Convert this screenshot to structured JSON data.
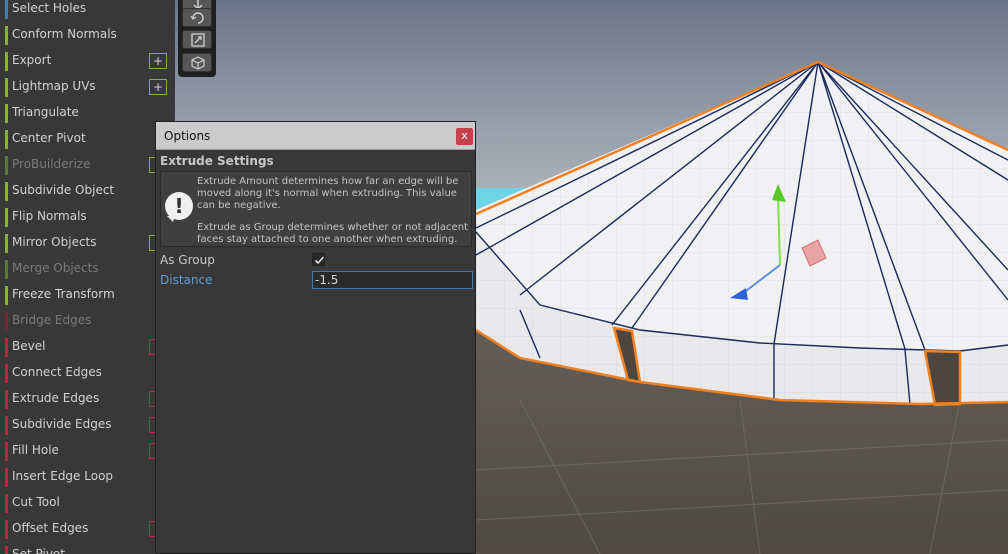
{
  "menu": {
    "items": [
      {
        "label": "Select Holes",
        "stripe": "#3c7fb5",
        "extra": "none",
        "disabled": false
      },
      {
        "label": "Conform Normals",
        "stripe": "#86b432",
        "extra": "none",
        "disabled": false
      },
      {
        "label": "Export",
        "stripe": "#86b432",
        "extra": "plus",
        "disabled": false
      },
      {
        "label": "Lightmap UVs",
        "stripe": "#86b432",
        "extra": "plus",
        "disabled": false
      },
      {
        "label": "Triangulate",
        "stripe": "#86b432",
        "extra": "none",
        "disabled": false
      },
      {
        "label": "Center Pivot",
        "stripe": "#86b432",
        "extra": "none",
        "disabled": false
      },
      {
        "label": "ProBuilderize",
        "stripe": "#5a7a30",
        "extra": "edge-green",
        "disabled": true
      },
      {
        "label": "Subdivide Object",
        "stripe": "#86b432",
        "extra": "none",
        "disabled": false
      },
      {
        "label": "Flip Normals",
        "stripe": "#86b432",
        "extra": "none",
        "disabled": false
      },
      {
        "label": "Mirror Objects",
        "stripe": "#86b432",
        "extra": "edge-green",
        "disabled": false
      },
      {
        "label": "Merge Objects",
        "stripe": "#5a7a30",
        "extra": "none",
        "disabled": true
      },
      {
        "label": "Freeze Transform",
        "stripe": "#86b432",
        "extra": "none",
        "disabled": false
      },
      {
        "label": "Bridge Edges",
        "stripe": "#6e2632",
        "extra": "none",
        "disabled": true
      },
      {
        "label": "Bevel",
        "stripe": "#b8273d",
        "extra": "edge",
        "disabled": false
      },
      {
        "label": "Connect Edges",
        "stripe": "#b8273d",
        "extra": "none",
        "disabled": false
      },
      {
        "label": "Extrude Edges",
        "stripe": "#b8273d",
        "extra": "edge",
        "disabled": false
      },
      {
        "label": "Subdivide Edges",
        "stripe": "#b8273d",
        "extra": "edge",
        "disabled": false
      },
      {
        "label": "Fill Hole",
        "stripe": "#b8273d",
        "extra": "edge",
        "disabled": false
      },
      {
        "label": "Insert Edge Loop",
        "stripe": "#b8273d",
        "extra": "none",
        "disabled": false
      },
      {
        "label": "Cut Tool",
        "stripe": "#b8273d",
        "extra": "none",
        "disabled": false
      },
      {
        "label": "Offset Edges",
        "stripe": "#b8273d",
        "extra": "edge",
        "disabled": false
      },
      {
        "label": "Set Pivot",
        "stripe": "#b8273d",
        "extra": "none",
        "disabled": false
      }
    ],
    "plus_symbol": "+"
  },
  "toolbox": {
    "icons": [
      "move-icon",
      "rotate-icon",
      "scale-icon",
      "transform-icon"
    ]
  },
  "options": {
    "title": "Options",
    "close": "x",
    "section": "Extrude Settings",
    "help_icon": "!",
    "help_para1": "Extrude Amount determines how far an edge will be moved along it's normal when extruding.  This value can be negative.",
    "help_para2": "Extrude as Group determines whether or not adjacent faces stay attached to one another when extruding.",
    "as_group_label": "As Group",
    "as_group_checked": true,
    "distance_label": "Distance",
    "distance_value": "-1.5"
  },
  "colors": {
    "accent_blue": "#5b9ddc",
    "edge_orange": "#f08020",
    "wire": "#1a2a5a"
  }
}
